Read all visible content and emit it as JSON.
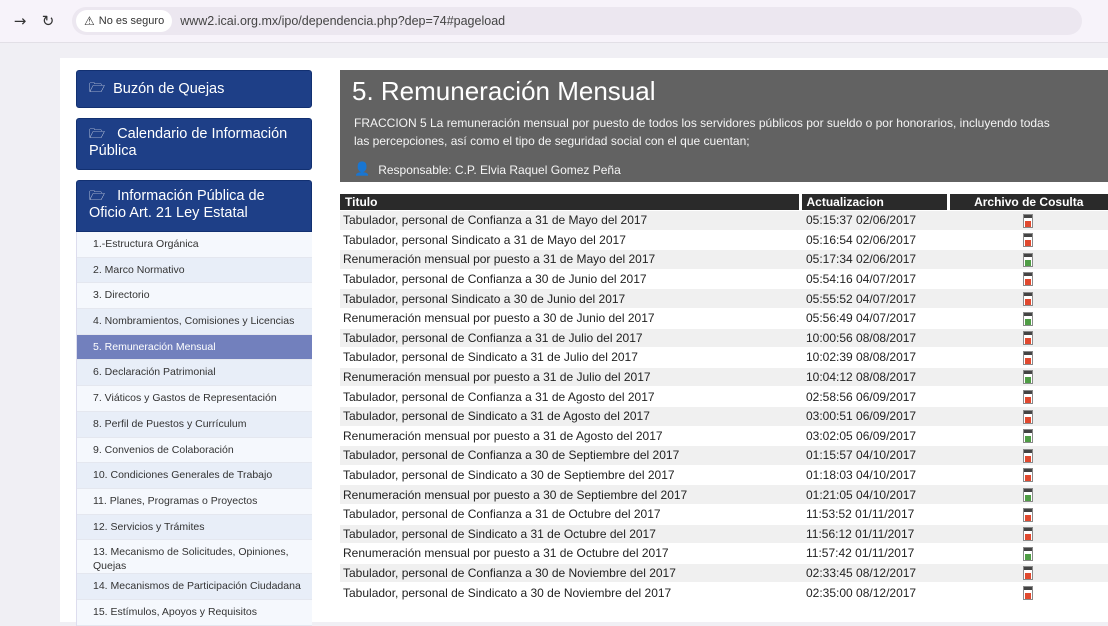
{
  "browser": {
    "forward_icon": "arrow-right-icon",
    "reload_icon": "reload-icon",
    "security_label": "No es seguro",
    "url": "www2.icai.org.mx/ipo/dependencia.php?dep=74#pageload"
  },
  "sidebar": {
    "headers": [
      {
        "label": "Buzón de Quejas"
      },
      {
        "label": "Calendario de Información Pública"
      },
      {
        "label": "Información Pública de Oficio Art. 21 Ley Estatal"
      }
    ],
    "items": [
      {
        "label": "1.-Estructura Orgánica"
      },
      {
        "label": "2. Marco Normativo"
      },
      {
        "label": "3. Directorio"
      },
      {
        "label": "4. Nombramientos, Comisiones y Licencias"
      },
      {
        "label": "5. Remuneración Mensual"
      },
      {
        "label": "6. Declaración Patrimonial"
      },
      {
        "label": "7. Viáticos y Gastos de Representación"
      },
      {
        "label": "8. Perfil de Puestos y Currículum"
      },
      {
        "label": "9. Convenios de Colaboración"
      },
      {
        "label": "10. Condiciones Generales de Trabajo"
      },
      {
        "label": "11. Planes, Programas o Proyectos"
      },
      {
        "label": "12. Servicios y Trámites"
      },
      {
        "label": "13. Mecanismo de Solicitudes, Opiniones, Quejas"
      },
      {
        "label": "14. Mecanismos de Participación Ciudadana"
      },
      {
        "label": "15. Estímulos, Apoyos y Requisitos"
      }
    ],
    "active_index": 4
  },
  "main": {
    "title": "5. Remuneración Mensual",
    "description_line1": "FRACCION 5 La remuneración mensual por puesto de todos los servidores públicos por sueldo o por honorarios, incluyendo todas",
    "description_line2": "las percepciones, así como el tipo de seguridad social con el que cuentan;",
    "responsable": "Responsable: C.P. Elvia Raquel Gomez Peña",
    "columns": {
      "titulo": "Titulo",
      "actualizacion": "Actualizacion",
      "archivo": "Archivo de Cosulta"
    },
    "rows": [
      {
        "titulo": "Tabulador, personal de Confianza a 31 de Mayo del 2017",
        "fecha": "05:15:37 02/06/2017",
        "file": "pdf"
      },
      {
        "titulo": "Tabulador, personal Sindicato a 31 de Mayo del 2017",
        "fecha": "05:16:54 02/06/2017",
        "file": "pdf"
      },
      {
        "titulo": "Renumeración mensual por puesto a 31 de Mayo del 2017",
        "fecha": "05:17:34 02/06/2017",
        "file": "xls"
      },
      {
        "titulo": "Tabulador, personal de Confianza a 30 de Junio del 2017",
        "fecha": "05:54:16 04/07/2017",
        "file": "pdf"
      },
      {
        "titulo": "Tabulador, personal Sindicato a 30 de Junio del 2017",
        "fecha": "05:55:52 04/07/2017",
        "file": "pdf"
      },
      {
        "titulo": "Renumeración mensual por puesto a 30 de Junio del 2017",
        "fecha": "05:56:49 04/07/2017",
        "file": "xls"
      },
      {
        "titulo": "Tabulador, personal de Confianza a 31 de Julio del 2017",
        "fecha": "10:00:56 08/08/2017",
        "file": "pdf"
      },
      {
        "titulo": "Tabulador, personal de Sindicato a 31 de Julio del 2017",
        "fecha": "10:02:39 08/08/2017",
        "file": "pdf"
      },
      {
        "titulo": "Renumeración mensual por puesto a 31 de Julio del 2017",
        "fecha": "10:04:12 08/08/2017",
        "file": "xls"
      },
      {
        "titulo": "Tabulador, personal de Confianza a 31 de Agosto del 2017",
        "fecha": "02:58:56 06/09/2017",
        "file": "pdf"
      },
      {
        "titulo": "Tabulador, personal de Sindicato a 31 de Agosto del 2017",
        "fecha": "03:00:51 06/09/2017",
        "file": "pdf"
      },
      {
        "titulo": "Renumeración mensual por puesto a 31 de Agosto del 2017",
        "fecha": "03:02:05 06/09/2017",
        "file": "xls"
      },
      {
        "titulo": "Tabulador, personal de Confianza a 30 de Septiembre del 2017",
        "fecha": "01:15:57 04/10/2017",
        "file": "pdf"
      },
      {
        "titulo": "Tabulador, personal de Sindicato a 30 de Septiembre del 2017",
        "fecha": "01:18:03 04/10/2017",
        "file": "pdf"
      },
      {
        "titulo": "Renumeración mensual por puesto a 30 de Septiembre del 2017",
        "fecha": "01:21:05 04/10/2017",
        "file": "xls"
      },
      {
        "titulo": "Tabulador, personal de Confianza a 31 de Octubre del 2017",
        "fecha": "11:53:52 01/11/2017",
        "file": "pdf"
      },
      {
        "titulo": "Tabulador, personal de Sindicato a 31 de Octubre del 2017",
        "fecha": "11:56:12 01/11/2017",
        "file": "pdf"
      },
      {
        "titulo": "Renumeración mensual por puesto a 31 de Octubre del 2017",
        "fecha": "11:57:42 01/11/2017",
        "file": "xls"
      },
      {
        "titulo": "Tabulador, personal de Confianza a 30 de Noviembre del 2017",
        "fecha": "02:33:45 08/12/2017",
        "file": "pdf"
      },
      {
        "titulo": "Tabulador, personal de Sindicato a 30 de Noviembre del 2017",
        "fecha": "02:35:00 08/12/2017",
        "file": "pdf"
      }
    ]
  }
}
